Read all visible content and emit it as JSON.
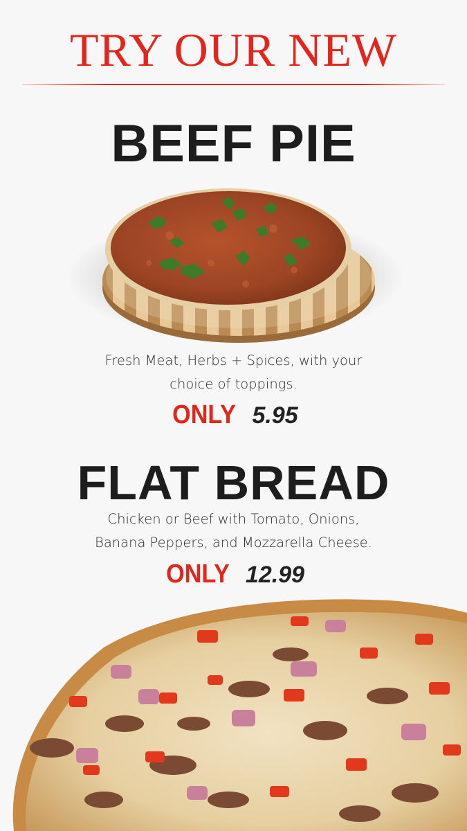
{
  "header": {
    "title": "TRY OUR NEW"
  },
  "items": [
    {
      "name": "BEEF PIE",
      "description_lines": [
        "Fresh Meat, Herbs + Spices, with your",
        "choice of toppings."
      ],
      "price_label": "ONLY",
      "price": "5.95",
      "image": "beef-pie-photo"
    },
    {
      "name": "FLAT BREAD",
      "description_lines": [
        "Chicken or Beef  with  Tomato, Onions,",
        "Banana Peppers, and Mozzarella Cheese."
      ],
      "price_label": "ONLY",
      "price": "12.99",
      "image": "flat-bread-photo"
    }
  ],
  "colors": {
    "accent": "#e3261b",
    "text": "#1d1d1d",
    "background": "#f7f7f7"
  }
}
